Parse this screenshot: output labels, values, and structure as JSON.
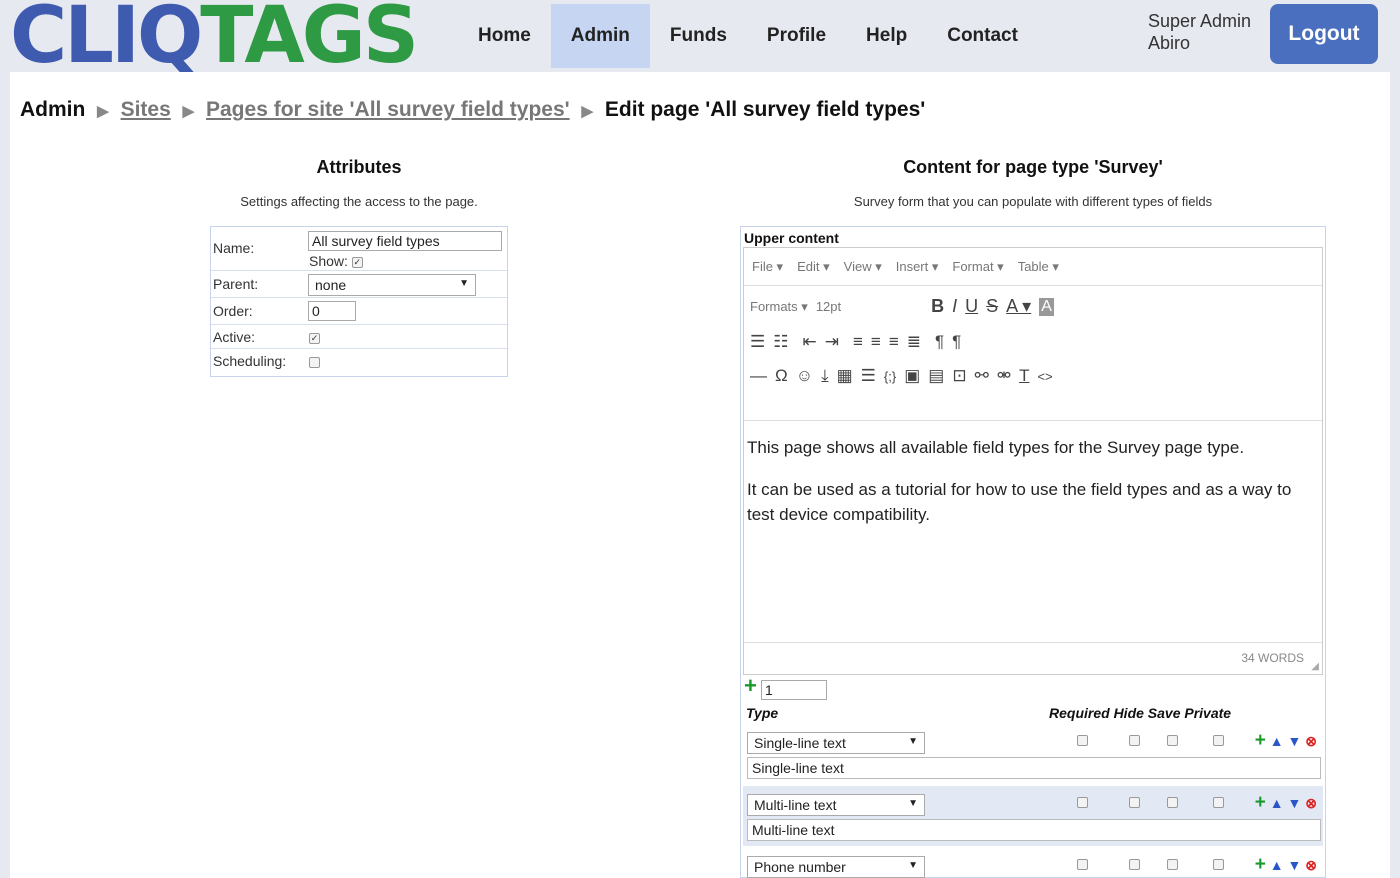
{
  "header": {
    "logo_part1": "CLIQ",
    "logo_part2": "TAGS",
    "nav": [
      "Home",
      "Admin",
      "Funds",
      "Profile",
      "Help",
      "Contact"
    ],
    "active_nav": "Admin",
    "user_line1": "Super Admin",
    "user_line2": "Abiro",
    "logout_label": "Logout"
  },
  "breadcrumb": {
    "root": "Admin",
    "sites": "Sites",
    "pages": "Pages for site 'All survey field types'",
    "current": "Edit page 'All survey field types'"
  },
  "attributes": {
    "title": "Attributes",
    "subtitle": "Settings affecting the access to the page.",
    "name_label": "Name:",
    "name_value": "All survey field types",
    "show_label": "Show:",
    "parent_label": "Parent:",
    "parent_value": "none",
    "order_label": "Order:",
    "order_value": "0",
    "active_label": "Active:",
    "scheduling_label": "Scheduling:"
  },
  "content_section": {
    "title": "Content for page type 'Survey'",
    "subtitle": "Survey form that you can populate with different types of fields",
    "upper_label": "Upper content",
    "menu": [
      "File ▾",
      "Edit ▾",
      "View ▾",
      "Insert ▾",
      "Format ▾",
      "Table ▾"
    ],
    "formats_label": "Formats ▾",
    "font_size": "12pt",
    "paragraph1": "This page shows all available field types for the Survey page type.",
    "paragraph2": "It can be used as a tutorial for how to use the field types and as a way to test device compatibility.",
    "word_count": "34 WORDS"
  },
  "fields": {
    "add_count": "1",
    "type_header": "Type",
    "flags_header": "Required Hide Save Private",
    "rows": [
      {
        "type": "Single-line text",
        "name": "Single-line text"
      },
      {
        "type": "Multi-line text",
        "name": "Multi-line text"
      },
      {
        "type": "Phone number",
        "name": ""
      }
    ]
  },
  "colors": {
    "logo_blue": "#3f5bb0",
    "logo_green": "#2e9a44",
    "active_nav": "#c6d5f2",
    "logout_button": "#4a6fbf"
  }
}
